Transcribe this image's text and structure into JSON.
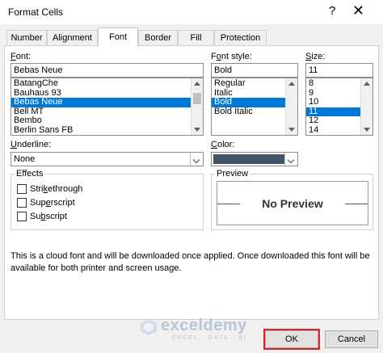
{
  "window": {
    "title": "Format Cells",
    "help_glyph": "?",
    "close_glyph": "✕"
  },
  "tabs": [
    {
      "label": "Number"
    },
    {
      "label": "Alignment"
    },
    {
      "label": "Font",
      "active": true
    },
    {
      "label": "Border"
    },
    {
      "label": "Fill"
    },
    {
      "label": "Protection"
    }
  ],
  "font": {
    "label": "Font:",
    "value": "Bebas Neue",
    "options": [
      "BatangChe",
      "Bauhaus 93",
      "Bebas Neue",
      "Bell MT",
      "Bembo",
      "Berlin Sans FB"
    ],
    "selected_index": 2
  },
  "font_style": {
    "label": "Font style:",
    "value": "Bold",
    "options": [
      "Regular",
      "Italic",
      "Bold",
      "Bold Italic"
    ],
    "selected_index": 2
  },
  "size": {
    "label": "Size:",
    "value": "11",
    "options": [
      "8",
      "9",
      "10",
      "11",
      "12",
      "14"
    ],
    "selected_index": 3
  },
  "underline": {
    "label": "Underline:",
    "value": "None"
  },
  "color": {
    "label": "Color:",
    "swatch": "#44546a"
  },
  "effects": {
    "label": "Effects",
    "items": [
      {
        "label": "Strikethrough",
        "checked": false
      },
      {
        "label": "Superscript",
        "checked": false
      },
      {
        "label": "Subscript",
        "checked": false
      }
    ]
  },
  "preview": {
    "label": "Preview",
    "text": "No Preview"
  },
  "note": "This is a cloud font and will be downloaded once applied. Once downloaded this font will be available for both printer and screen usage.",
  "buttons": {
    "ok": "OK",
    "cancel": "Cancel"
  },
  "watermark": {
    "name": "exceldemy",
    "tagline": "EXCEL · DATA · BI"
  },
  "colors": {
    "selection": "#0078d7",
    "ok_highlight": "#e0202a"
  }
}
